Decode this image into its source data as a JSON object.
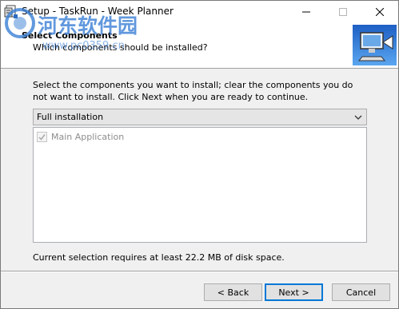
{
  "window": {
    "title": "Setup - TaskRun - Week Planner"
  },
  "header": {
    "title": "Select Components",
    "subtitle": "Which components should be installed?"
  },
  "watermark": {
    "line1": "河东软件园",
    "line2": "www.pc0359.cn"
  },
  "body": {
    "instructions": "Select the components you want to install; clear the components you do not want to install. Click Next when you are ready to continue.",
    "install_type": {
      "selected": "Full installation"
    },
    "components": [
      {
        "label": "Main Application",
        "checked": true,
        "enabled": false
      }
    ],
    "disk_info": "Current selection requires at least 22.2 MB of disk space."
  },
  "buttons": {
    "back": "< Back",
    "next": "Next >",
    "cancel": "Cancel"
  },
  "colors": {
    "accent": "#0078d7",
    "watermark_blue": "#3a7fd5"
  }
}
